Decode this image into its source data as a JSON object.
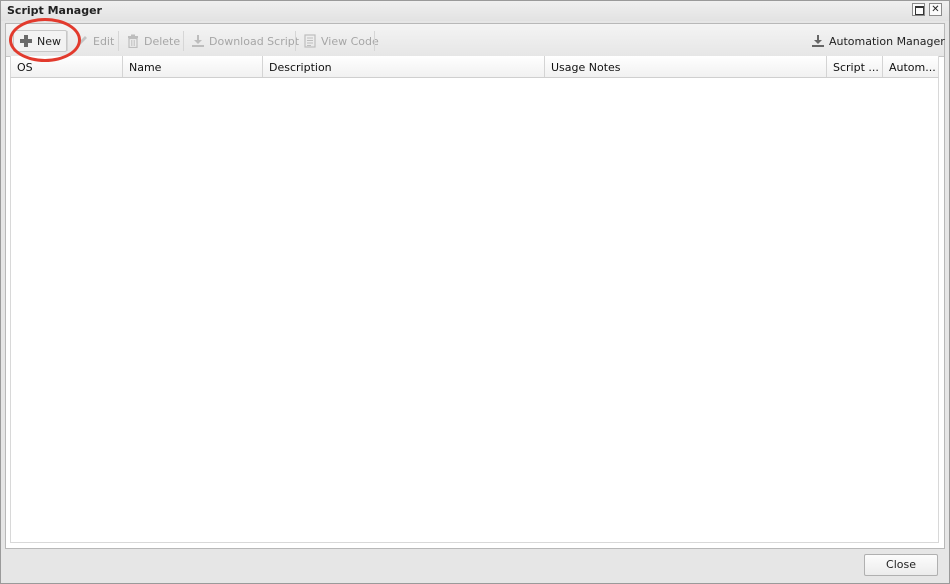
{
  "window": {
    "title": "Script Manager"
  },
  "toolbar": {
    "new_label": "New",
    "edit_label": "Edit",
    "delete_label": "Delete",
    "download_label": "Download Script",
    "view_code_label": "View Code",
    "automation_label": "Automation Manager"
  },
  "grid": {
    "columns": [
      "OS",
      "Name",
      "Description",
      "Usage Notes",
      "Script ...",
      "Autom..."
    ],
    "rows": []
  },
  "footer": {
    "close_label": "Close"
  },
  "colors": {
    "highlight": "#e23a2d",
    "disabled_text": "#a6a6a6"
  },
  "icons": {
    "new": "plus-icon",
    "edit": "pencil-icon",
    "delete": "trash-icon",
    "download": "download-icon",
    "view_code": "document-icon",
    "automation": "download-icon"
  }
}
